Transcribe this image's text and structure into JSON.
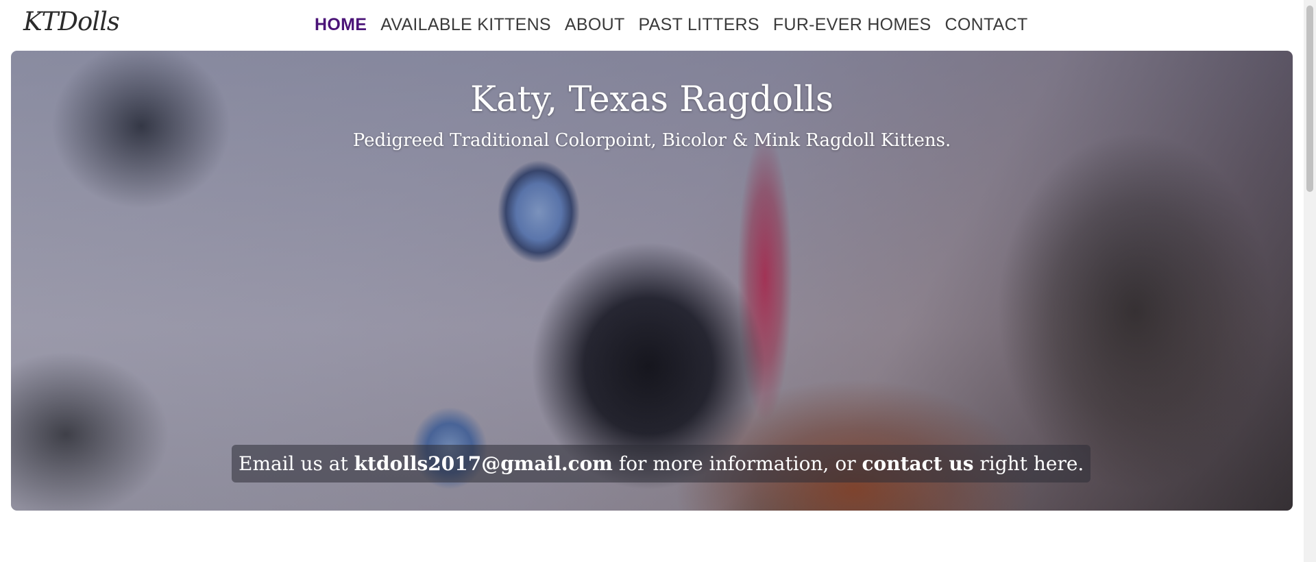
{
  "brand": {
    "logo_text": "KTDolls"
  },
  "nav": {
    "items": [
      {
        "label": "HOME",
        "active": true
      },
      {
        "label": "AVAILABLE KITTENS",
        "active": false
      },
      {
        "label": "ABOUT",
        "active": false
      },
      {
        "label": "PAST LITTERS",
        "active": false
      },
      {
        "label": "FUR-EVER HOMES",
        "active": false
      },
      {
        "label": "CONTACT",
        "active": false
      }
    ],
    "active_color": "#4b1478"
  },
  "hero": {
    "title": "Katy, Texas Ragdolls",
    "subtitle": "Pedigreed Traditional Colorpoint, Bicolor & Mink Ragdoll Kittens.",
    "background_image": "ragdoll-kitten-closeup",
    "cta": {
      "prefix": "Email us at ",
      "email": "ktdolls2017@gmail.com",
      "middle": " for more information, or ",
      "link_label": "contact us",
      "suffix": " right here."
    }
  }
}
